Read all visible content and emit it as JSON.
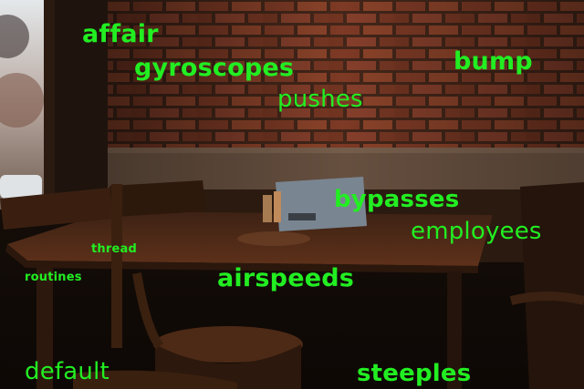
{
  "scene": {
    "description_colors": {
      "brick": "#8a3f26",
      "mortar": "#5a3a2a",
      "wood": "#5a2e18",
      "window_light": "#cfd6dc",
      "overlay_text": "#22ee22"
    }
  },
  "overlay_words": [
    "affair",
    "gyroscopes",
    "bump",
    "pushes",
    "bypasses",
    "employees",
    "thread",
    "routines",
    "airspeeds",
    "default",
    "steeples"
  ]
}
